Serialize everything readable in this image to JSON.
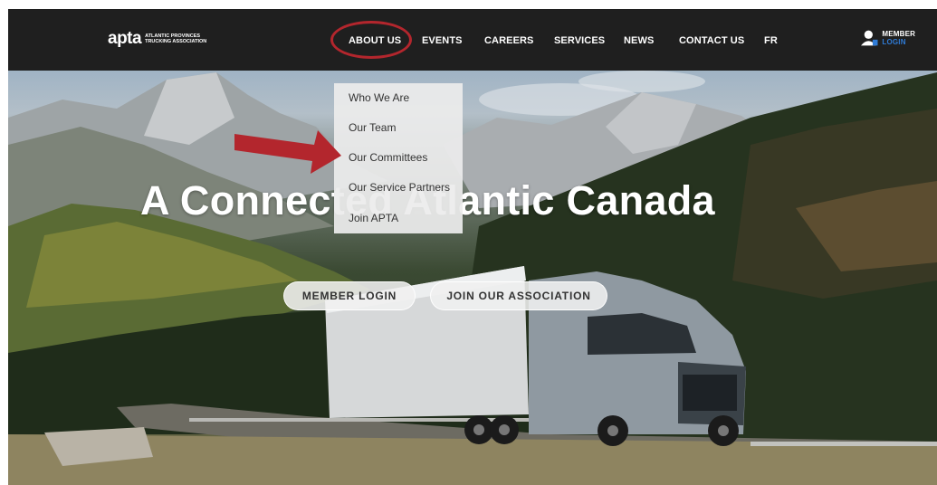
{
  "brand": {
    "name": "apta",
    "subtitle": "ATLANTIC PROVINCES TRUCKING ASSOCIATION"
  },
  "nav": {
    "items": [
      {
        "id": "about",
        "label": "ABOUT US"
      },
      {
        "id": "events",
        "label": "EVENTS"
      },
      {
        "id": "careers",
        "label": "CAREERS"
      },
      {
        "id": "services",
        "label": "SERVICES"
      },
      {
        "id": "news",
        "label": "NEWS"
      },
      {
        "id": "contact",
        "label": "CONTACT US"
      },
      {
        "id": "fr",
        "label": "FR"
      }
    ],
    "member": {
      "prefix": "MEMBER ",
      "suffix": "LOGIN"
    }
  },
  "dropdown": {
    "items": [
      "Who We Are",
      "Our Team",
      "Our Committees",
      "Our Service Partners",
      "Join APTA"
    ]
  },
  "hero": {
    "headline": "A Connected Atlantic Canada",
    "buttons": {
      "member_login": "MEMBER LOGIN",
      "join": "JOIN OUR ASSOCIATION"
    }
  },
  "colors": {
    "nav_bg": "#1f1f1f",
    "highlight": "#b3262d",
    "accent_blue": "#2f7bd6"
  }
}
